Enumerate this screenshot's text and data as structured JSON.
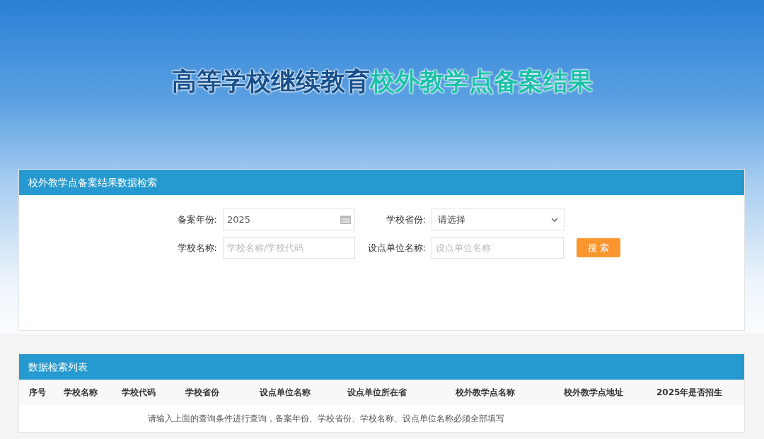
{
  "banner": {
    "title_part_1": "高等学校继续教育",
    "title_part_2": "校外教学点备案结果"
  },
  "search_panel": {
    "title": "校外教学点备案结果数据检索",
    "fields": [
      {
        "label": "备案年份:",
        "value": "2025",
        "kind": "date"
      },
      {
        "label": "学校省份:",
        "value": "请选择",
        "kind": "select"
      },
      {
        "label": "学校名称:",
        "placeholder": "学校名称/学校代码",
        "kind": "text"
      },
      {
        "label": "设点单位名称:",
        "placeholder": "设点单位名称",
        "kind": "text"
      }
    ],
    "search_button": "搜 索"
  },
  "results": {
    "title": "数据检索列表",
    "columns": [
      "序号",
      "学校名称",
      "学校代码",
      "学校省份",
      "设点单位名称",
      "设点单位所在省",
      "校外教学点名称",
      "校外教学点地址",
      "2025年是否招生"
    ],
    "empty_message": "请输入上面的查询条件进行查询，备案年份、学校省份、学校名称、设点单位名称必须全部填写"
  }
}
